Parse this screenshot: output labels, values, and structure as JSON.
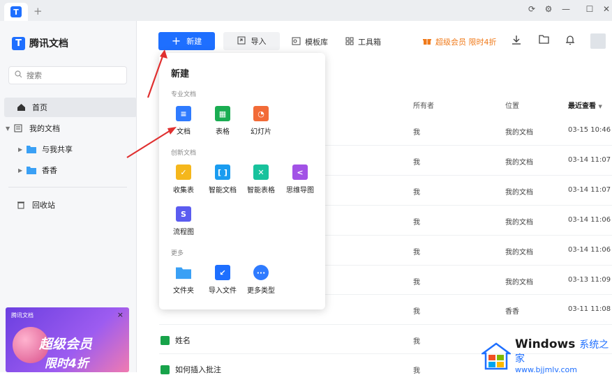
{
  "titlebar": {
    "tab_logo": "T",
    "new_tab": "+",
    "controls": [
      "⟳",
      "⚙",
      "—",
      "☐",
      "✕"
    ]
  },
  "sidebar": {
    "brand": "腾讯文档",
    "search_placeholder": "搜索",
    "items": [
      {
        "label": "首页",
        "icon": "home-icon"
      },
      {
        "label": "我的文档",
        "icon": "doc-folder-icon"
      },
      {
        "label": "与我共享",
        "icon": "shared-folder-icon"
      },
      {
        "label": "香香",
        "icon": "folder-icon"
      },
      {
        "label": "回收站",
        "icon": "trash-icon"
      }
    ],
    "promo": {
      "brand": "腾讯文档",
      "line1": "超级会员",
      "line2": "限时4折",
      "close": "×"
    }
  },
  "toolbar": {
    "new_label": "新建",
    "import_label": "导入",
    "template_label": "模板库",
    "tools_label": "工具箱",
    "vip_label": "超级会员 限时4折"
  },
  "table": {
    "headers": {
      "owner": "所有者",
      "location": "位置",
      "recent": "最近查看"
    },
    "rows": [
      {
        "name": "",
        "owner": "我",
        "location": "我的文档",
        "date": "03-15 10:46"
      },
      {
        "name": "",
        "owner": "我",
        "location": "我的文档",
        "date": "03-14 11:07"
      },
      {
        "name": "",
        "owner": "我",
        "location": "我的文档",
        "date": "03-14 11:07"
      },
      {
        "name": "",
        "owner": "我",
        "location": "我的文档",
        "date": "03-14 11:06"
      },
      {
        "name": "",
        "owner": "我",
        "location": "我的文档",
        "date": "03-14 11:06"
      },
      {
        "name": "",
        "owner": "我",
        "location": "我的文档",
        "date": "03-13 11:09"
      },
      {
        "name": "",
        "owner": "我",
        "location": "香香",
        "date": "03-11 11:08"
      },
      {
        "name": "姓名",
        "owner": "我",
        "location": "",
        "date": ""
      },
      {
        "name": "如何插入批注",
        "owner": "我",
        "location": "",
        "date": ""
      }
    ]
  },
  "popup": {
    "title": "新建",
    "sections": {
      "pro": "专业文档",
      "creative": "创新文档",
      "more": "更多"
    },
    "pro_items": [
      {
        "label": "文档",
        "color": "#2f7bff",
        "glyph": "≡"
      },
      {
        "label": "表格",
        "color": "#1aad52",
        "glyph": "▦"
      },
      {
        "label": "幻灯片",
        "color": "#f26b38",
        "glyph": "◔"
      }
    ],
    "creative_items": [
      {
        "label": "收集表",
        "color": "#f5b71c",
        "glyph": "✓"
      },
      {
        "label": "智能文档",
        "color": "#1a9cf0",
        "glyph": "[ ]"
      },
      {
        "label": "智能表格",
        "color": "#18c29c",
        "glyph": "✕"
      },
      {
        "label": "思维导图",
        "color": "#a252e6",
        "glyph": "<"
      },
      {
        "label": "流程图",
        "color": "#5b5cf0",
        "glyph": "S"
      }
    ],
    "more_items": [
      {
        "label": "文件夹",
        "color": "#3aa0f5",
        "glyph": ""
      },
      {
        "label": "导入文件",
        "color": "#1e6fff",
        "glyph": "↙"
      },
      {
        "label": "更多类型",
        "color": "#2f7bff",
        "glyph": "···"
      }
    ]
  },
  "watermark": {
    "line1_a": "Windows",
    "line1_b": "系统之家",
    "line2": "www.bjjmlv.com"
  }
}
